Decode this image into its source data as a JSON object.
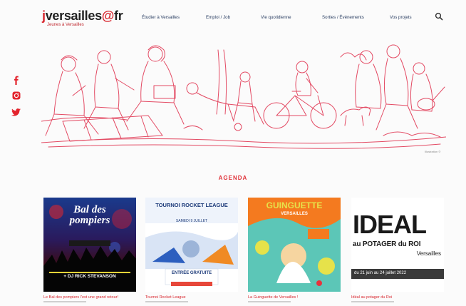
{
  "logo": {
    "main": "versailles",
    "j": "j",
    "tld": "fr",
    "tagline": "Jeunes à Versailles"
  },
  "nav": [
    "Étudier à Versailles",
    "Emploi / Job",
    "Vie quotidienne",
    "Sorties / Événements",
    "Vos projets"
  ],
  "icons": {
    "search": "search-icon",
    "facebook": "facebook-icon",
    "instagram": "instagram-icon",
    "twitter": "twitter-icon"
  },
  "hero": {
    "credit": "Illustration ©"
  },
  "agenda": {
    "title": "AGENDA",
    "cards": [
      {
        "poster_title": "Bal des pompiers",
        "poster_line1": "+ DJ RICK STEVANSON",
        "caption": "Le Bal des pompiers l'est une grand retour!"
      },
      {
        "poster_title": "TOURNOI ROCKET LEAGUE",
        "poster_line1": "SAMEDI 9 JUILLET",
        "poster_line2": "ENTRÉE GRATUITE",
        "caption": "Tournoi Rocket League"
      },
      {
        "poster_title": "GUINGUETTE",
        "poster_line1": "VERSAILLES",
        "caption": "La Guinguette de Versailles !"
      },
      {
        "poster_title": "IDEAL",
        "poster_line1": "au POTAGER du ROI",
        "poster_line2": "Versailles",
        "poster_line3": "du 21 juin au 24 juillet 2022",
        "caption": "Idéal au potager du Roi"
      }
    ]
  },
  "colors": {
    "brand": "#d8262e",
    "nav": "#2b3f63",
    "hero_line": "#e34a63"
  }
}
